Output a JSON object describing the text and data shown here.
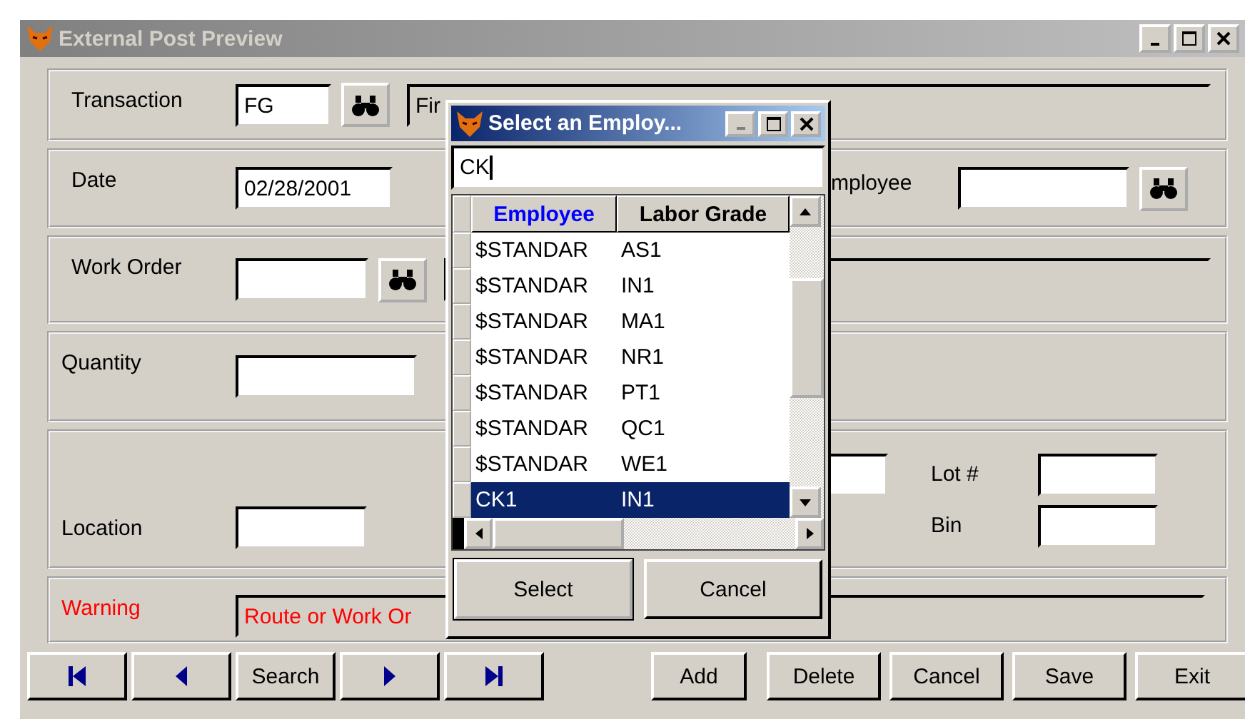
{
  "window": {
    "title": "External Post Preview"
  },
  "form": {
    "transaction": {
      "label": "Transaction",
      "code": "FG",
      "description": "Fir"
    },
    "date": {
      "label": "Date",
      "value": "02/28/2001"
    },
    "employee": {
      "label": "mployee"
    },
    "work_order": {
      "label": "Work Order"
    },
    "quantity": {
      "label": "Quantity"
    },
    "location": {
      "label": "Location"
    },
    "lot": {
      "label": "Lot #"
    },
    "bin": {
      "label": "Bin"
    },
    "warning": {
      "label": "Warning",
      "message": "Route or Work Or"
    }
  },
  "nav_buttons": [
    {
      "kind": "first"
    },
    {
      "kind": "prev"
    },
    {
      "kind": "text",
      "label": "Search"
    },
    {
      "kind": "next"
    },
    {
      "kind": "last"
    }
  ],
  "action_buttons": [
    "Add",
    "Delete",
    "Cancel",
    "Save",
    "Exit"
  ],
  "dialog": {
    "title": "Select an Employ...",
    "search": "CK",
    "columns": [
      {
        "label": "Employee",
        "sorted": true
      },
      {
        "label": "Labor Grade",
        "sorted": false
      }
    ],
    "rows": [
      {
        "cells": [
          "$STANDAR",
          "AS1"
        ],
        "selected": false
      },
      {
        "cells": [
          "$STANDAR",
          "IN1"
        ],
        "selected": false
      },
      {
        "cells": [
          "$STANDAR",
          "MA1"
        ],
        "selected": false
      },
      {
        "cells": [
          "$STANDAR",
          "NR1"
        ],
        "selected": false
      },
      {
        "cells": [
          "$STANDAR",
          "PT1"
        ],
        "selected": false
      },
      {
        "cells": [
          "$STANDAR",
          "QC1"
        ],
        "selected": false
      },
      {
        "cells": [
          "$STANDAR",
          "WE1"
        ],
        "selected": false
      },
      {
        "cells": [
          "CK1",
          "IN1"
        ],
        "selected": true
      }
    ],
    "buttons": [
      "Select",
      "Cancel"
    ]
  }
}
